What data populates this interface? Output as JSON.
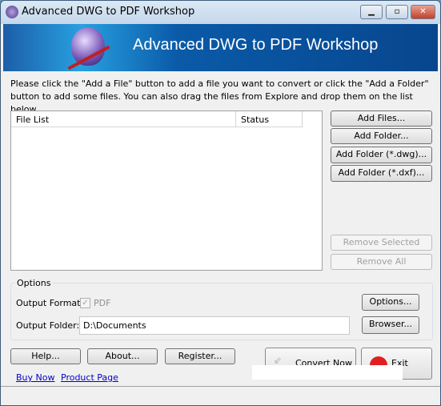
{
  "window": {
    "title": "Advanced DWG to PDF Workshop",
    "minimize": "▁",
    "maximize": "▫",
    "close": "✕"
  },
  "banner": {
    "title": "Advanced DWG to PDF Workshop"
  },
  "instructions": "Please click the \"Add a File\" button to add a file you want to convert or click the \"Add a Folder\" button to add some files. You can also drag the files from Explore and drop them on the list below.",
  "file_list": {
    "columns": [
      "File List",
      "Status"
    ],
    "rows": []
  },
  "side_buttons": {
    "add_files": "Add Files...",
    "add_folder": "Add Folder...",
    "add_folder_dwg": "Add Folder (*.dwg)...",
    "add_folder_dxf": "Add Folder (*.dxf)...",
    "remove_selected": "Remove Selected",
    "remove_all": "Remove All"
  },
  "options": {
    "group_label": "Options",
    "output_format_label": "Output Format:",
    "output_format_checked": true,
    "output_format_value": "PDF",
    "output_folder_label": "Output Folder:",
    "output_folder_value": "D:\\Documents",
    "options_button": "Options...",
    "browser_button": "Browser..."
  },
  "bottom": {
    "help": "Help...",
    "about": "About...",
    "register": "Register...",
    "convert": "Convert Now",
    "exit": "Exit",
    "buy_now": "Buy Now",
    "product_page": "Product Page"
  }
}
